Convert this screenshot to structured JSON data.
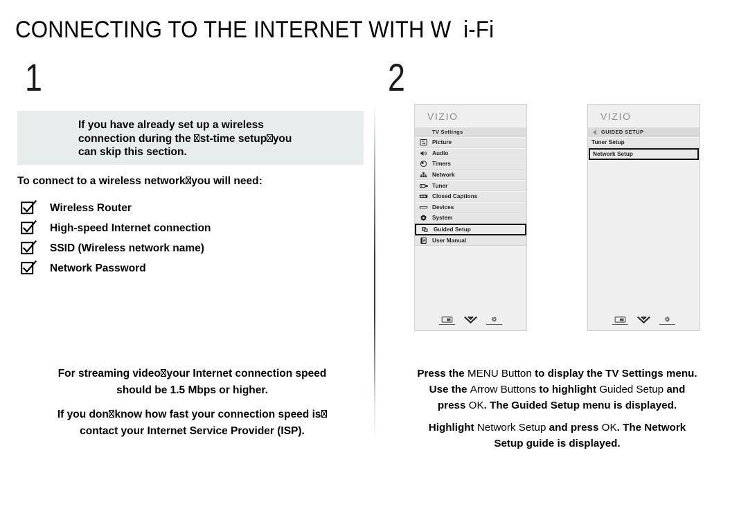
{
  "page": {
    "title_part_1": "CONNECTING TO THE INTERNET WITH W",
    "title_gap": "  ",
    "title_part_2": "i-Fi",
    "title_full": "CONNECTING TO THE INTERNET WITH W  i-Fi"
  },
  "steps": {
    "one": "1",
    "two": "2"
  },
  "left": {
    "info_box": {
      "line1": "If you have already set up a wireless",
      "line2_a": "connection during the ",
      "line2_tofu1": "fi",
      "line2_b": "st-time setup",
      "line2_tofu2": ",",
      "line2_c": "you",
      "line3": "can skip this section."
    },
    "lead": {
      "text_a": "To connect to a wireless network",
      "tofu": ",",
      "text_b": "you will need:"
    },
    "checklist": [
      {
        "icon": "checkbox-checked-icon",
        "label": "Wireless Router"
      },
      {
        "icon": "checkbox-checked-icon",
        "label": "High-speed Internet connection"
      },
      {
        "icon": "checkbox-checked-icon",
        "label": "SSID (Wireless network name)"
      },
      {
        "icon": "checkbox-checked-icon",
        "label": "Network Password"
      }
    ],
    "footnote": {
      "p1_a": "For streaming video",
      "p1_tofu": ",",
      "p1_b": "your Internet connection speed",
      "p1_c": "should be 1.5 Mbps or higher.",
      "p2_a": "If you don",
      "p2_tofu1": "'",
      "p2_b": "know how fast your connection speed is",
      "p2_tofu2": ",",
      "p2_c": "contact your Internet Service Provider (ISP)."
    }
  },
  "right": {
    "tv_screen_1": {
      "brand": "VIZIO",
      "header": "TV Settings",
      "rows": [
        {
          "icon": "picture-icon",
          "label": "Picture",
          "selected": false
        },
        {
          "icon": "audio-speaker-icon",
          "label": "Audio",
          "selected": false
        },
        {
          "icon": "clock-timer-icon",
          "label": "Timers",
          "selected": false
        },
        {
          "icon": "network-icon",
          "label": "Network",
          "selected": false
        },
        {
          "icon": "tuner-icon",
          "label": "Tuner",
          "selected": false
        },
        {
          "icon": "closed-captions-icon",
          "label": "Closed Captions",
          "selected": false
        },
        {
          "icon": "devices-icon",
          "label": "Devices",
          "selected": false
        },
        {
          "icon": "gear-system-icon",
          "label": "System",
          "selected": false
        },
        {
          "icon": "guided-setup-icon",
          "label": "Guided Setup",
          "selected": true
        },
        {
          "icon": "user-manual-icon",
          "label": "User Manual",
          "selected": false
        }
      ],
      "footer_icons": [
        "picture-mode-icon",
        "chevron-double-down-icon",
        "brightness-gear-icon"
      ]
    },
    "tv_screen_2": {
      "brand": "VIZIO",
      "header": "GUIDED SETUP",
      "back_icon": "back-arrow-icon",
      "rows": [
        {
          "label": "Tuner Setup",
          "selected": false
        },
        {
          "label": "Network Setup",
          "selected": true
        }
      ],
      "footer_icons": [
        "picture-mode-icon",
        "chevron-double-down-icon",
        "brightness-gear-icon"
      ]
    },
    "instructions": {
      "p1_s1": "Press the",
      "p1_s2": "MENU Button",
      "p1_s3": "to display the TV Settings menu.",
      "p1_s4": "Use the",
      "p1_s5": "Arrow Buttons",
      "p1_s6": "to highlight",
      "p1_s7": "Guided Setup",
      "p1_s8": "and",
      "p1_s9": "press",
      "p1_s10": "OK",
      "p1_s11": ". The Guided Setup menu is displayed.",
      "p2_s1": "Highlight",
      "p2_s2": "Network Setup",
      "p2_s3": "and press",
      "p2_s4": "OK",
      "p2_s5": ". The Network",
      "p2_s6": "Setup guide is displayed."
    }
  },
  "colors": {
    "info_box_bg": "#e7ecec",
    "tv_panel_bg": "#efefef",
    "tv_row_bg": "#e6e6e6",
    "tv_header_bg": "#dcdcdc",
    "selection_border": "#111111",
    "brand_text": "#8d8d8d"
  }
}
